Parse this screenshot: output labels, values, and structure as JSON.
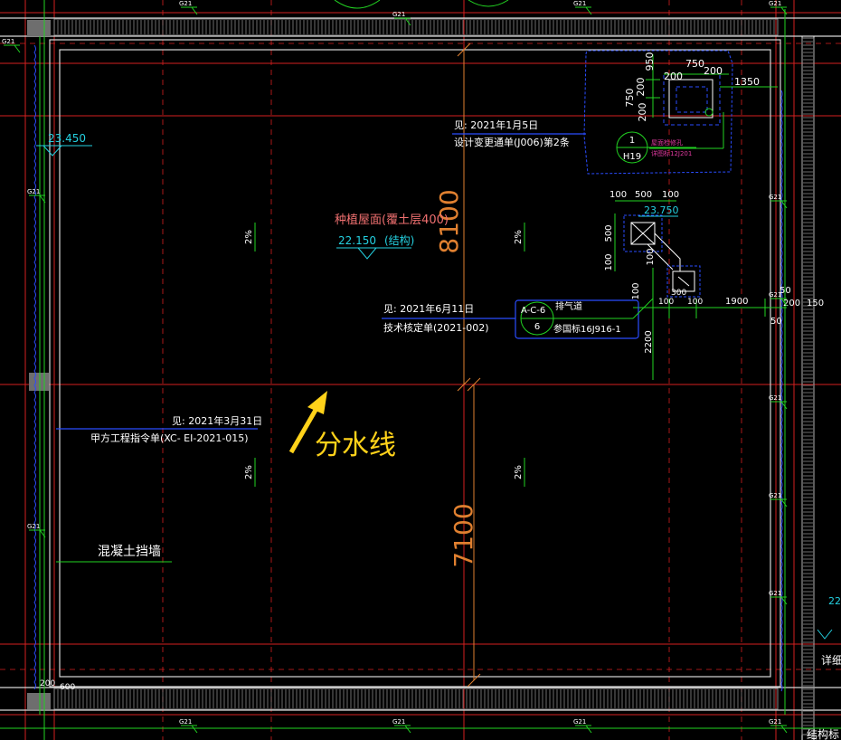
{
  "colors": {
    "background": "#000000",
    "axis_red": "#d42020",
    "wall_white": "#d8d8d8",
    "hatch_gray": "#8a8a8a",
    "blue": "#2a4cff",
    "cyan": "#24d0e0",
    "green": "#22d322",
    "orange": "#e08030",
    "magenta": "#e03aa0",
    "salmon": "#f07070",
    "yellow": "#ffd21a",
    "white": "#ffffff"
  },
  "main": {
    "dim_vertical_top": "8100",
    "dim_vertical_bottom": "7100",
    "drainage_divide_label": "分水线",
    "retaining_wall_label": "混凝土挡墙",
    "roof_title": "种植屋面(覆土层400)",
    "roof_elevation": "22.150",
    "roof_elevation_note": "(结构)",
    "elevation_top_left": "23.450",
    "elevation_vent": "23.750",
    "elevation_right_edge": "22",
    "slope_label": "2%"
  },
  "notes": {
    "note_jan5_line1": "见: 2021年1月5日",
    "note_jan5_line2": "设计变更通单(J006)第2条",
    "note_jun11_line1": "见: 2021年6月11日",
    "note_jun11_line2": "技术核定单(2021-002)",
    "note_mar31_line1": "见: 2021年3月31日",
    "note_mar31_line2": "甲方工程指令单(XC- EI-2021-015)"
  },
  "callouts": {
    "h19_top": "1",
    "h19_bottom": "H19",
    "h19_text1": "屋面检修孔",
    "h19_text2": "详图标12J201",
    "acc6_code": "A-C-6",
    "acc6_num": "6",
    "acc6_text1": "排气道",
    "acc6_text2": "参国标16J916-1"
  },
  "dims": {
    "d950": "950",
    "d750_top": "750",
    "d200_a": "200",
    "d200_b": "200",
    "d1350": "1350",
    "d200_c": "200",
    "d750_left": "750",
    "d200_d": "200",
    "d100_a": "100",
    "d500_a": "500",
    "d100_b": "100",
    "d500_v": "500",
    "d100_v": "100",
    "d100_e": "100",
    "d100_f": "100",
    "d300": "300",
    "d1900": "1900",
    "d200_e": "200",
    "d150": "150",
    "d50_a": "50",
    "d50_b": "50",
    "d2200": "2200",
    "d100_g": "100",
    "d200_bottom": "200",
    "d600_bottom": "600",
    "d100_h": "100"
  },
  "sections": {
    "section_tag": "G21",
    "right_detail_text": "详细",
    "bottom_right_text": "结构标"
  }
}
